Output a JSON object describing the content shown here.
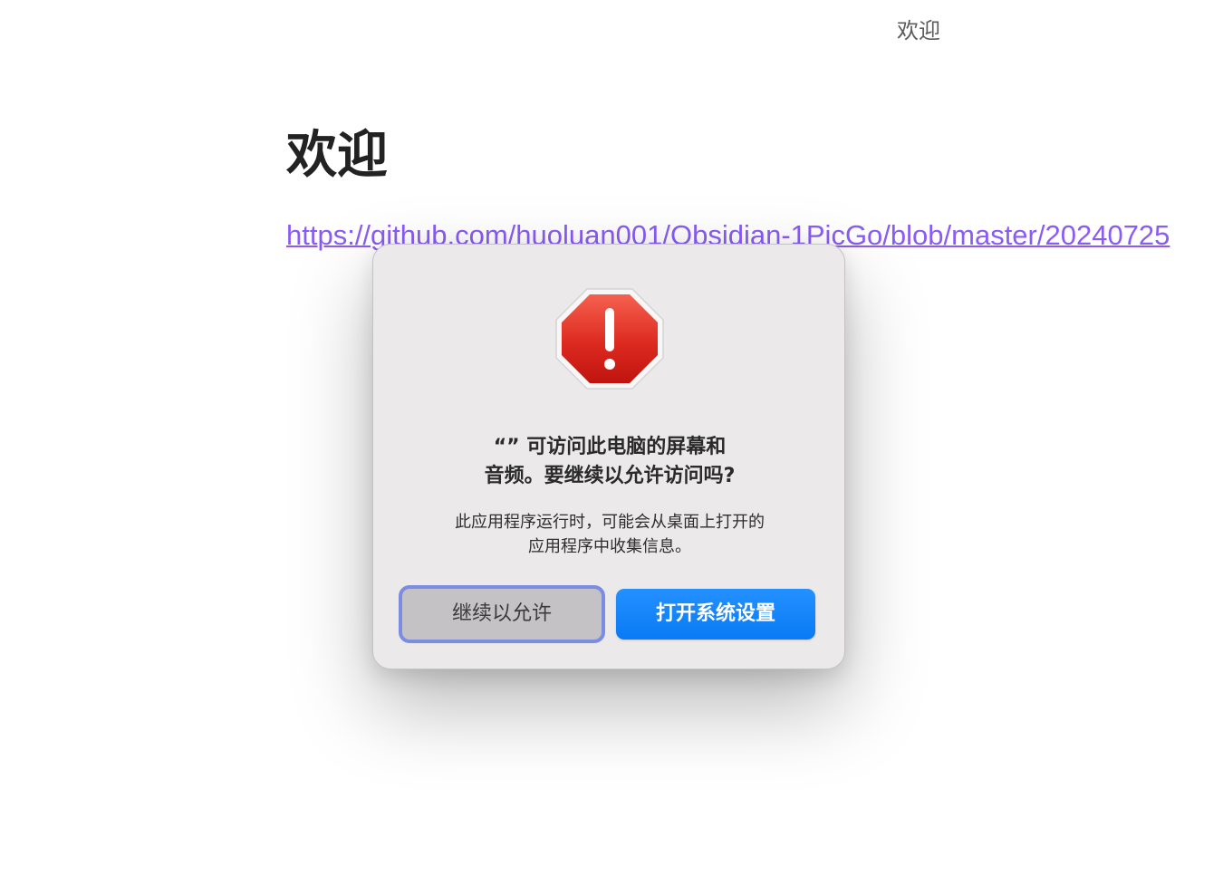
{
  "tab": {
    "title": "欢迎"
  },
  "note": {
    "heading": "欢迎",
    "link_text": "https://github.com/huoluan001/Obsidian-1PicGo/blob/master/20240725"
  },
  "dialog": {
    "icon": "stop-alert-icon",
    "title_line1": "“” 可访问此电脑的屏幕和",
    "title_line2": "音频。要继续以允许访问吗?",
    "message_line1": "此应用程序运行时，可能会从桌面上打开的",
    "message_line2": "应用程序中收集信息。",
    "button_secondary": "继续以允许",
    "button_primary": "打开系统设置"
  },
  "colors": {
    "link": "#8a5cf5",
    "primary_button": "#0a7af5",
    "alert_red": "#d92b21",
    "focus_ring": "#7a8de0"
  }
}
